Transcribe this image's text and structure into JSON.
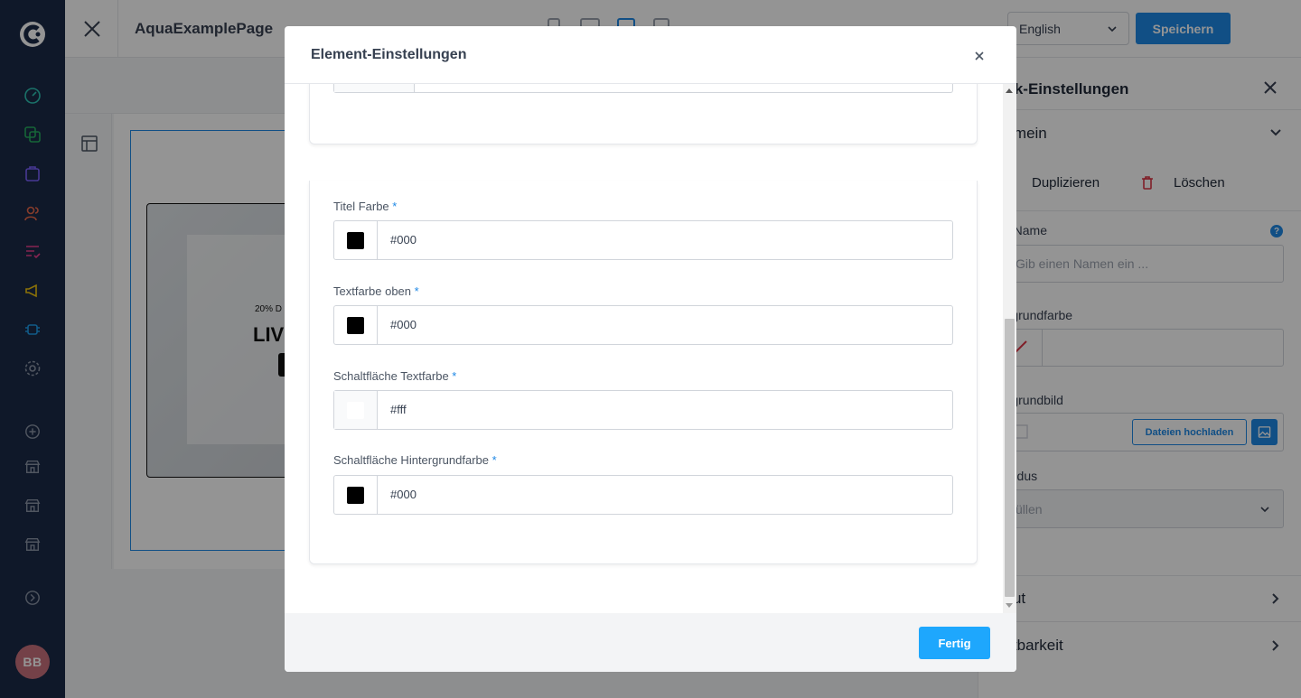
{
  "topbar": {
    "page_title": "AquaExamplePage",
    "language": "English",
    "save_label": "Speichern"
  },
  "canvas": {
    "banner_small": "20% D",
    "banner_big": "LIV"
  },
  "sidebar": {
    "icons": [
      "dashboard-icon",
      "pages-icon",
      "shop-icon",
      "users-icon",
      "list-icon",
      "megaphone-icon",
      "plugin-icon",
      "settings-icon",
      "add-circle-icon",
      "store-icon",
      "store-icon",
      "store-icon",
      "arrow-right-circle-icon"
    ],
    "avatar": "BB"
  },
  "right_panel": {
    "title": "ock-Einstellungen",
    "section_general": "gemein",
    "duplicate_label": "Duplizieren",
    "delete_label": "Löschen",
    "block_name_label": "ck-Name",
    "block_name_placeholder": "Gib einen Namen ein ...",
    "bg_color_label": "tergrundfarbe",
    "bg_image_label": "tergrundbild",
    "upload_label": "Dateien hochladen",
    "fill_mode_label": "lmodus",
    "fill_mode_value": "üllen",
    "section_layout": "yout",
    "section_visibility": "chtbarkeit"
  },
  "modal": {
    "title": "Element-Einstellungen",
    "fields": [
      {
        "label": "Titel Farbe",
        "required": "*",
        "value": "#000",
        "swatch": "#000000"
      },
      {
        "label": "Textfarbe oben",
        "required": "*",
        "value": "#000",
        "swatch": "#000000"
      },
      {
        "label": "Schaltfläche Textfarbe",
        "required": "*",
        "value": "#fff",
        "swatch": "#ffffff"
      },
      {
        "label": "Schaltfläche Hintergrundfarbe",
        "required": "*",
        "value": "#000",
        "swatch": "#000000"
      }
    ],
    "done_label": "Fertig"
  },
  "colors": {
    "sidebar_bg": "#1b2a47",
    "accent": "#1e88e5",
    "done_button": "#1ea7fd",
    "overlay": "rgba(0,0,0,0.42)"
  }
}
